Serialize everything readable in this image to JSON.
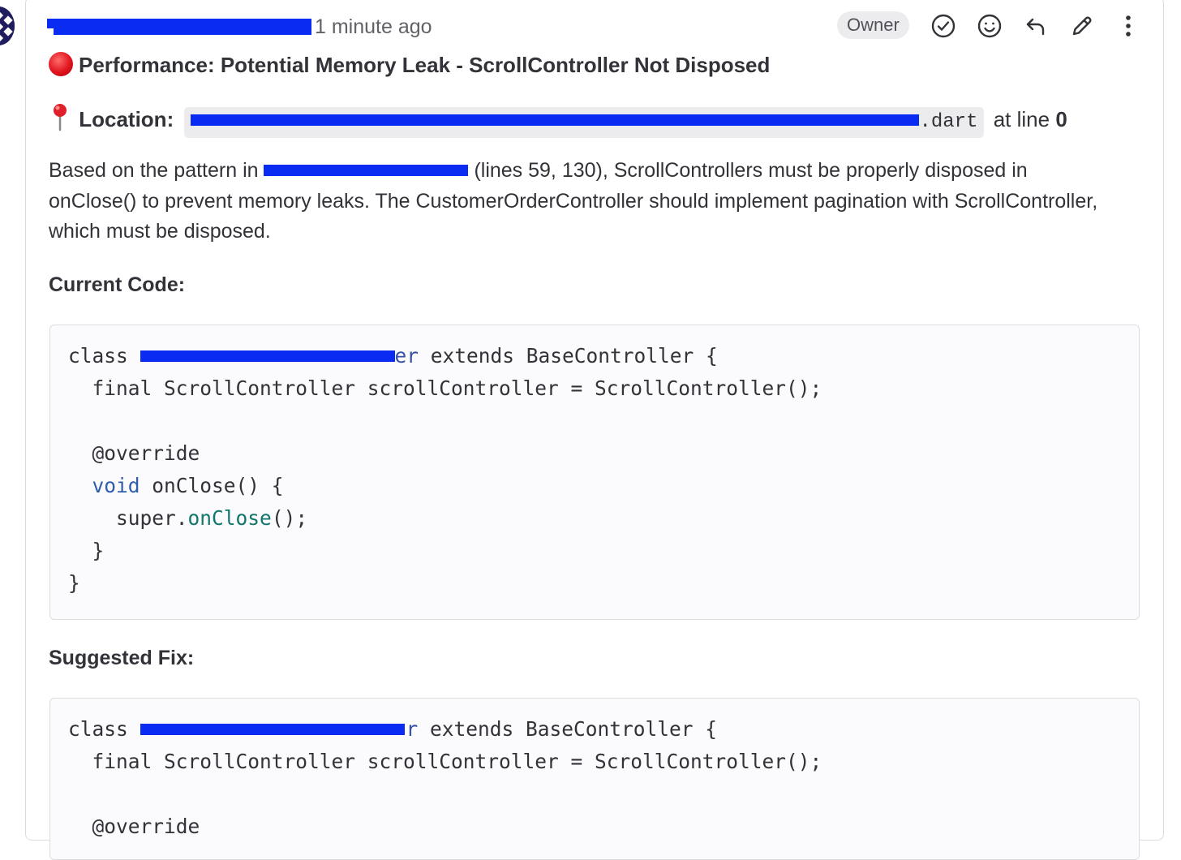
{
  "comment": {
    "author": "",
    "time": "1 minute ago",
    "badge": "Owner",
    "title": "Performance: Potential Memory Leak - ScrollController Not Disposed",
    "location_label": "Location:",
    "location_path_suffix": ".dart",
    "location_line_text": "at line",
    "location_line_number": "0",
    "desc_part1": "Based on the pattern in",
    "desc_part2": "(lines 59, 130), ScrollControllers must be properly disposed in onClose() to prevent memory leaks. The CustomerOrderController should implement pagination with ScrollController, which must be disposed.",
    "current_heading": "Current Code:",
    "fix_heading": "Suggested Fix:"
  },
  "current_code": {
    "l1_class": "class",
    "l1_name_tail": "er",
    "l1_rest": " extends BaseController {",
    "l2": "  final ScrollController scrollController = ScrollController();",
    "l4": "  @override",
    "l5_kw": "void",
    "l5_rest": " onClose() {",
    "l6_super": "super",
    "l6_dot": ".",
    "l6_fn": "onClose",
    "l6_end": "();",
    "l7": "  }",
    "l8": "}"
  },
  "fix_code": {
    "l1_class": "class",
    "l1_name_tail": "r",
    "l1_rest": " extends BaseController {",
    "l2": "  final ScrollController scrollController = ScrollController();",
    "l4": "  @override"
  },
  "icons": [
    "resolve-check-icon",
    "emoji-smile-icon",
    "reply-arrow-icon",
    "edit-pencil-icon",
    "more-vertical-icon",
    "red-circle-icon",
    "pushpin-icon"
  ],
  "colors": {
    "redaction": "#0a2bf2",
    "badge_bg": "#ececef",
    "keyword_blue": "#2f5cab",
    "function_teal": "#11766c"
  }
}
